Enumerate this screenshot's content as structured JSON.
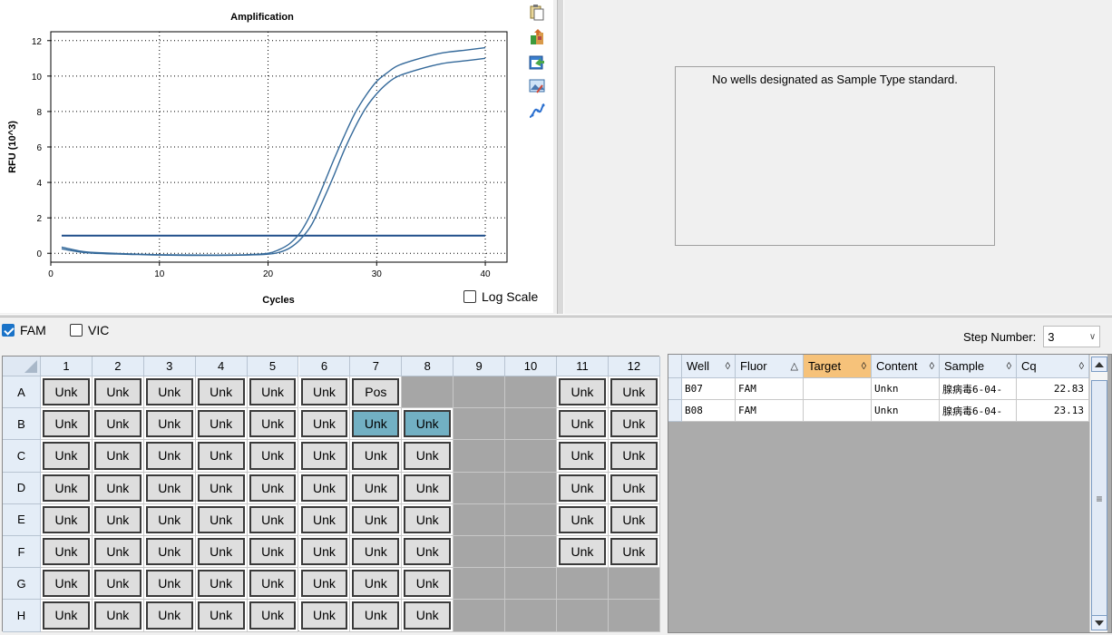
{
  "chart": {
    "title": "Amplification",
    "xlabel": "Cycles",
    "ylabel": "RFU (10^3)",
    "log_scale_label": "Log Scale",
    "log_scale_checked": false
  },
  "chart_data": {
    "type": "line",
    "title": "Amplification",
    "xlabel": "Cycles",
    "ylabel": "RFU (10^3)",
    "xlim": [
      0,
      42
    ],
    "ylim": [
      -0.5,
      12.5
    ],
    "xticks": [
      0,
      10,
      20,
      30,
      40
    ],
    "yticks": [
      0,
      2,
      4,
      6,
      8,
      10,
      12
    ],
    "grid": true,
    "threshold": 1.0,
    "series": [
      {
        "x": [
          1,
          3,
          5,
          8,
          10,
          14,
          18,
          20,
          21,
          22,
          23,
          24,
          25,
          26,
          27,
          28,
          29,
          30,
          31,
          32,
          34,
          36,
          38,
          40
        ],
        "values": [
          0.35,
          0.1,
          0.02,
          -0.05,
          -0.08,
          -0.1,
          -0.08,
          0.0,
          0.2,
          0.55,
          1.2,
          2.3,
          3.7,
          5.2,
          6.6,
          7.9,
          8.9,
          9.7,
          10.2,
          10.6,
          11.0,
          11.3,
          11.45,
          11.6
        ]
      },
      {
        "x": [
          1,
          3,
          5,
          8,
          10,
          14,
          18,
          20,
          21,
          22,
          23,
          24,
          25,
          26,
          27,
          28,
          29,
          30,
          31,
          32,
          34,
          36,
          38,
          40
        ],
        "values": [
          0.25,
          0.05,
          -0.02,
          -0.07,
          -0.1,
          -0.12,
          -0.1,
          -0.05,
          0.05,
          0.3,
          0.8,
          1.6,
          2.9,
          4.3,
          5.8,
          7.1,
          8.2,
          9.0,
          9.6,
          10.0,
          10.4,
          10.7,
          10.85,
          11.0
        ]
      }
    ]
  },
  "tools": [
    "copy-icon",
    "export-icon",
    "export-data-icon",
    "image-icon",
    "curve-icon"
  ],
  "standard_curve": {
    "message": "No wells designated as Sample Type standard."
  },
  "fluorophores": [
    {
      "label": "FAM",
      "checked": true
    },
    {
      "label": "VIC",
      "checked": false
    }
  ],
  "step": {
    "label": "Step Number:",
    "value": "3"
  },
  "plate": {
    "columns": [
      "1",
      "2",
      "3",
      "4",
      "5",
      "6",
      "7",
      "8",
      "9",
      "10",
      "11",
      "12"
    ],
    "rows": [
      "A",
      "B",
      "C",
      "D",
      "E",
      "F",
      "G",
      "H"
    ],
    "wells": {
      "A": [
        "Unk",
        "Unk",
        "Unk",
        "Unk",
        "Unk",
        "Unk",
        "Pos",
        "",
        "",
        "",
        "Unk",
        "Unk"
      ],
      "B": [
        "Unk",
        "Unk",
        "Unk",
        "Unk",
        "Unk",
        "Unk",
        "Unk",
        "Unk",
        "",
        "",
        "Unk",
        "Unk"
      ],
      "C": [
        "Unk",
        "Unk",
        "Unk",
        "Unk",
        "Unk",
        "Unk",
        "Unk",
        "Unk",
        "",
        "",
        "Unk",
        "Unk"
      ],
      "D": [
        "Unk",
        "Unk",
        "Unk",
        "Unk",
        "Unk",
        "Unk",
        "Unk",
        "Unk",
        "",
        "",
        "Unk",
        "Unk"
      ],
      "E": [
        "Unk",
        "Unk",
        "Unk",
        "Unk",
        "Unk",
        "Unk",
        "Unk",
        "Unk",
        "",
        "",
        "Unk",
        "Unk"
      ],
      "F": [
        "Unk",
        "Unk",
        "Unk",
        "Unk",
        "Unk",
        "Unk",
        "Unk",
        "Unk",
        "",
        "",
        "Unk",
        "Unk"
      ],
      "G": [
        "Unk",
        "Unk",
        "Unk",
        "Unk",
        "Unk",
        "Unk",
        "Unk",
        "Unk",
        "",
        "",
        "",
        ""
      ],
      "H": [
        "Unk",
        "Unk",
        "Unk",
        "Unk",
        "Unk",
        "Unk",
        "Unk",
        "Unk",
        "",
        "",
        "",
        ""
      ]
    },
    "selected": [
      "B7",
      "B8"
    ]
  },
  "results": {
    "headers": [
      {
        "label": "Well",
        "sort": "◊"
      },
      {
        "label": "Fluor",
        "sort": "△"
      },
      {
        "label": "Target",
        "sort": "◊"
      },
      {
        "label": "Content",
        "sort": "◊"
      },
      {
        "label": "Sample",
        "sort": "◊"
      },
      {
        "label": "Cq",
        "sort": "◊"
      }
    ],
    "rows": [
      [
        "B07",
        "FAM",
        "",
        "Unkn",
        "腺病毒6-04-",
        "22.83"
      ],
      [
        "B08",
        "FAM",
        "",
        "Unkn",
        "腺病毒6-04-",
        "23.13"
      ]
    ]
  },
  "colors": {
    "curve": "#34699a",
    "threshold": "#1f4e8a",
    "selected_well": "#72b0c3",
    "active_header": "#f6c27a",
    "checkbox": "#1a73c8"
  }
}
